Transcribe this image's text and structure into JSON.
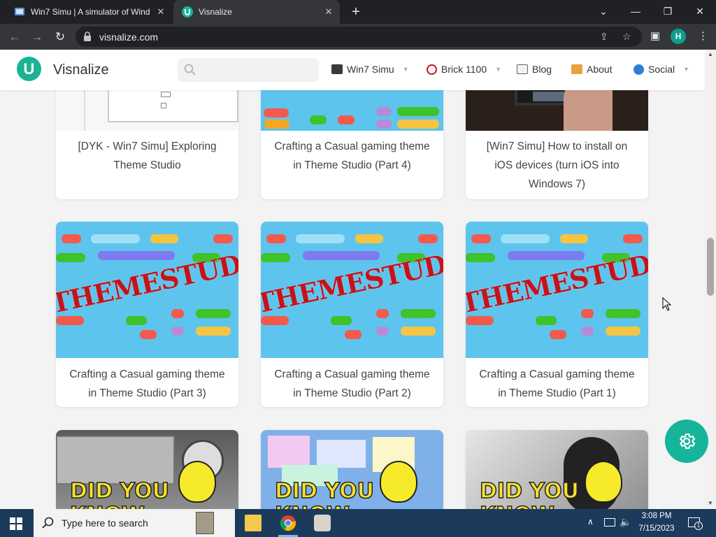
{
  "browser": {
    "tabs": [
      {
        "title": "Win7 Simu | A simulator of Wind",
        "close": "✕"
      },
      {
        "title": "Visnalize",
        "close": "✕"
      }
    ],
    "new_tab": "+",
    "window_controls": {
      "dropdown": "⌄",
      "minimize": "—",
      "restore": "❐",
      "close": "✕"
    },
    "url": "visnalize.com",
    "profile_initial": "H"
  },
  "site": {
    "name": "Visnalize",
    "logo_letter": "U",
    "search": {
      "placeholder": ""
    },
    "nav": [
      {
        "label": "Win7 Simu",
        "has_dropdown": true
      },
      {
        "label": "Brick 1100",
        "has_dropdown": true
      },
      {
        "label": "Blog",
        "has_dropdown": false
      },
      {
        "label": "About",
        "has_dropdown": false
      },
      {
        "label": "Social",
        "has_dropdown": true
      }
    ],
    "caret": "▼"
  },
  "cards_row1": [
    {
      "title": "[DYK - Win7 Simu] Exploring Theme Studio"
    },
    {
      "title": "Crafting a Casual gaming theme in Theme Studio (Part 4)"
    },
    {
      "title": "[Win7 Simu] How to install on iOS devices (turn iOS into Windows 7)"
    }
  ],
  "cards_row2": [
    {
      "title": "Crafting a Casual gaming theme in Theme Studio (Part 3)",
      "stamp": "THEMESTUDIO"
    },
    {
      "title": "Crafting a Casual gaming theme in Theme Studio (Part 2)",
      "stamp": "THEMESTUDIO"
    },
    {
      "title": "Crafting a Casual gaming theme in Theme Studio (Part 1)",
      "stamp": "THEMESTUDIO"
    }
  ],
  "cards_row3": [
    {
      "thumb_text_1": "DID YOU",
      "thumb_text_2": "KNOW"
    },
    {
      "thumb_text_1": "DID YOU",
      "thumb_text_2": "KNOW"
    },
    {
      "thumb_text_1": "DID YOU",
      "thumb_text_2": "KNOW"
    }
  ],
  "taskbar": {
    "search_placeholder": "Type here to search",
    "time": "3:08 PM",
    "date": "7/15/2023",
    "notification_count": "1"
  },
  "colors": {
    "accent": "#16b49a",
    "taskbar": "#1b3a5c",
    "stamp_red": "#c4141a"
  }
}
